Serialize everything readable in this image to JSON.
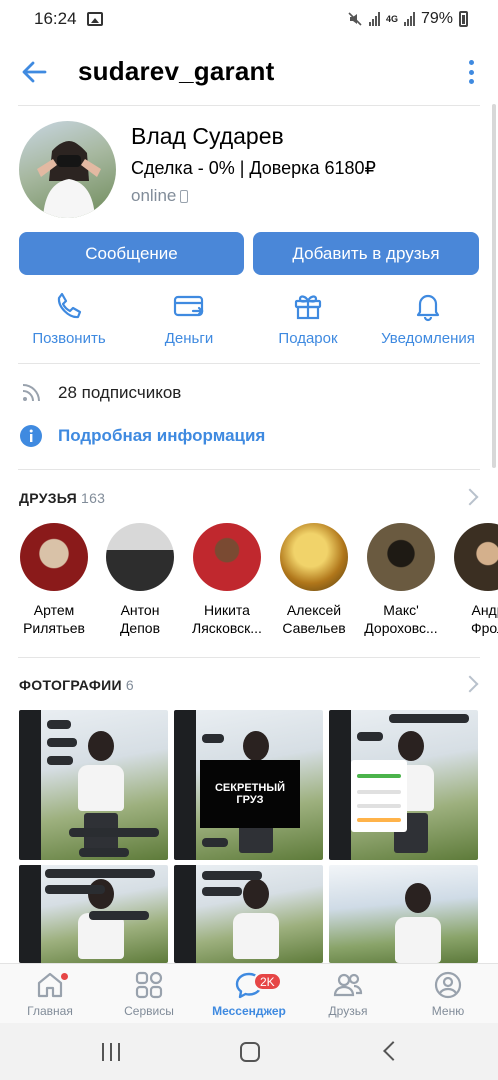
{
  "status_bar": {
    "time": "16:24",
    "battery": "79%",
    "network": "4G"
  },
  "header": {
    "title": "sudarev_garant"
  },
  "profile": {
    "name": "Влад Сударев",
    "status": "Сделка - 0% | Доверка 6180₽",
    "online": "online"
  },
  "buttons": {
    "message": "Сообщение",
    "add_friend": "Добавить в друзья"
  },
  "actions": [
    {
      "label": "Позвонить",
      "icon": "phone-icon"
    },
    {
      "label": "Деньги",
      "icon": "money-icon"
    },
    {
      "label": "Подарок",
      "icon": "gift-icon"
    },
    {
      "label": "Уведомления",
      "icon": "bell-icon"
    }
  ],
  "info": {
    "subscribers": "28 подписчиков",
    "details": "Подробная информация"
  },
  "friends": {
    "title": "ДРУЗЬЯ",
    "count": "163",
    "items": [
      {
        "line1": "Артем",
        "line2": "Рилятьев",
        "color": "#8a1a1a"
      },
      {
        "line1": "Антон",
        "line2": "Депов",
        "color": "#3a3a3a"
      },
      {
        "line1": "Никита",
        "line2": "Лясковск...",
        "color": "#c0282e"
      },
      {
        "line1": "Алексей",
        "line2": "Савельев",
        "color": "#c99a22"
      },
      {
        "line1": "Макс'",
        "line2": "Дороховс...",
        "color": "#4a4032"
      },
      {
        "line1": "Андр",
        "line2": "Фрол",
        "color": "#5a4a30"
      }
    ]
  },
  "photos": {
    "title": "ФОТОГРАФИИ",
    "count": "6",
    "secret_label": "СЕКРЕТНЫЙ ГРУЗ"
  },
  "bottom_nav": [
    {
      "label": "Главная",
      "icon": "home-icon"
    },
    {
      "label": "Сервисы",
      "icon": "services-icon"
    },
    {
      "label": "Мессенджер",
      "icon": "messenger-icon",
      "badge": "2K",
      "active": true
    },
    {
      "label": "Друзья",
      "icon": "friends-icon"
    },
    {
      "label": "Меню",
      "icon": "menu-icon"
    }
  ],
  "colors": {
    "accent": "#3f8ae0",
    "button": "#4a87d8",
    "badge": "#e64646",
    "secondary_text": "#818c99"
  }
}
